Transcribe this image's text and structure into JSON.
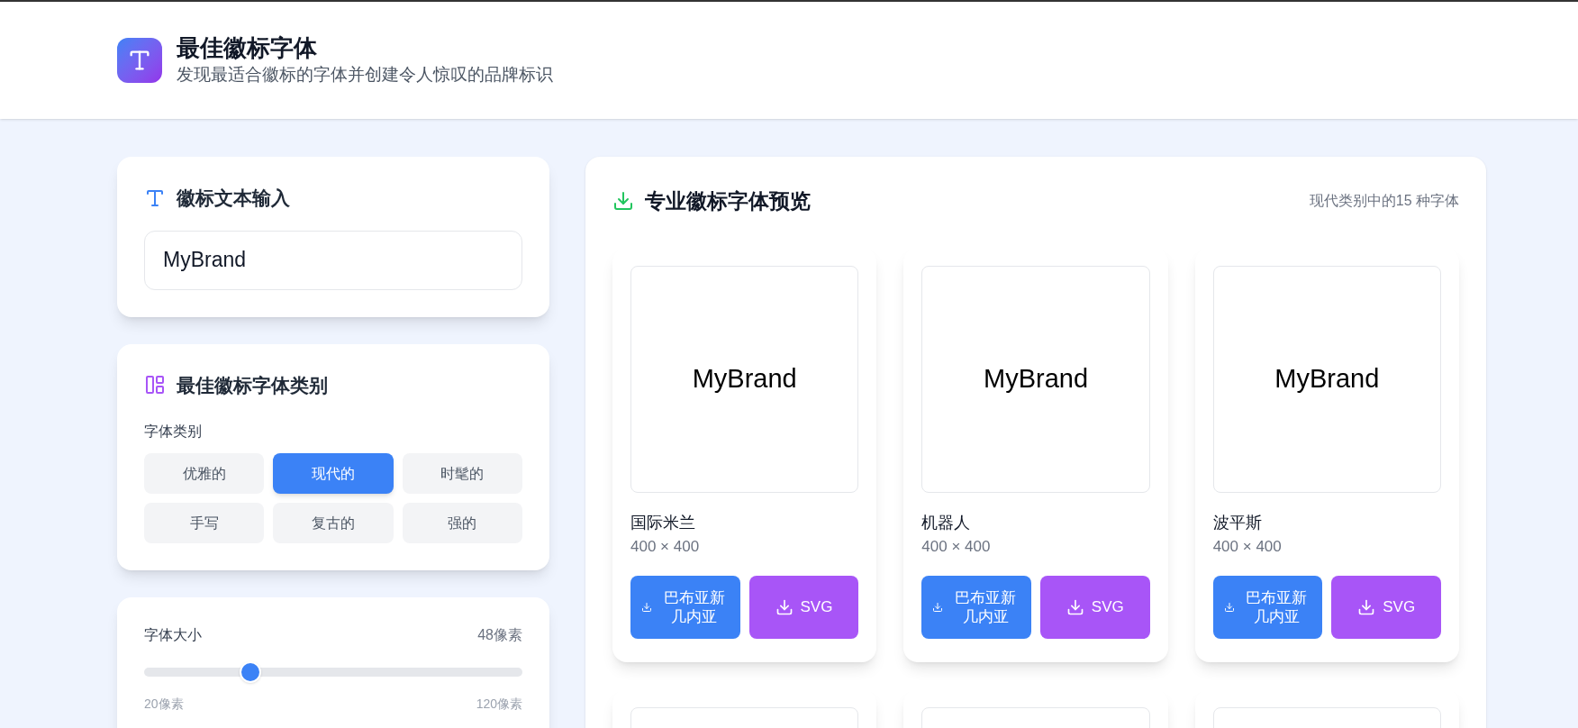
{
  "header": {
    "title": "最佳徽标字体",
    "subtitle": "发现最适合徽标的字体并创建令人惊叹的品牌标识"
  },
  "text_input": {
    "title": "徽标文本输入",
    "value": "MyBrand"
  },
  "categories": {
    "title": "最佳徽标字体类别",
    "label": "字体类别",
    "options": [
      {
        "label": "优雅的",
        "selected": false
      },
      {
        "label": "现代的",
        "selected": true
      },
      {
        "label": "时髦的",
        "selected": false
      },
      {
        "label": "手写",
        "selected": false
      },
      {
        "label": "复古的",
        "selected": false
      },
      {
        "label": "强的",
        "selected": false
      }
    ]
  },
  "font_size": {
    "label": "字体大小",
    "reading": "48像素",
    "level": 0.28,
    "min_label": "20像素",
    "max_label": "120像素"
  },
  "preview": {
    "title": "专业徽标字体预览",
    "count": "现代类别中的15 种字体",
    "fonts": [
      {
        "kind": "font",
        "sample": "MyBrand",
        "name": "国际米兰",
        "size": "400 × 400",
        "png_button": "巴布亚新几内亚",
        "svg_button": "SVG"
      },
      {
        "kind": "font",
        "sample": "MyBrand",
        "name": "机器人",
        "size": "400 × 400",
        "png_button": "巴布亚新几内亚",
        "svg_button": "SVG"
      },
      {
        "kind": "font",
        "sample": "MyBrand",
        "name": "波平斯",
        "size": "400 × 400",
        "png_button": "巴布亚新几内亚",
        "svg_button": "SVG"
      },
      {
        "kind": "partial"
      },
      {
        "kind": "partial"
      },
      {
        "kind": "partial"
      }
    ]
  }
}
